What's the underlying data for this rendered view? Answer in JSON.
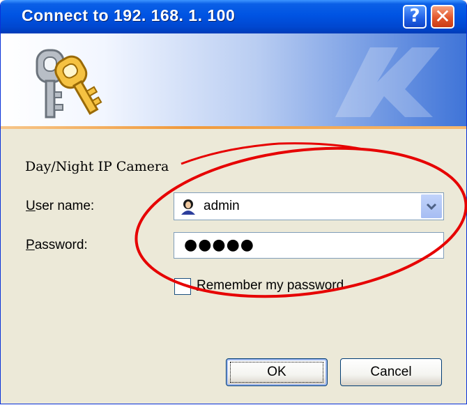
{
  "window": {
    "title": "Connect to 192. 168. 1. 100",
    "help_glyph": "?",
    "close_glyph": "✕"
  },
  "banner": {
    "icon": "keys-icon"
  },
  "dialog": {
    "caption": "Day/Night IP Camera",
    "username_label_mnemonic": "U",
    "username_label_rest": "ser name:",
    "username_value": "admin",
    "password_label_mnemonic": "P",
    "password_label_rest": "assword:",
    "password_mask": "●●●●●",
    "remember_mnemonic": "R",
    "remember_rest": "emember my password",
    "remember_checked": false
  },
  "buttons": {
    "ok_label": "OK",
    "cancel_label": "Cancel"
  },
  "colors": {
    "titlebar": "#0054e3",
    "annotation_ellipse": "#e60000",
    "close_button": "#e2572c"
  }
}
